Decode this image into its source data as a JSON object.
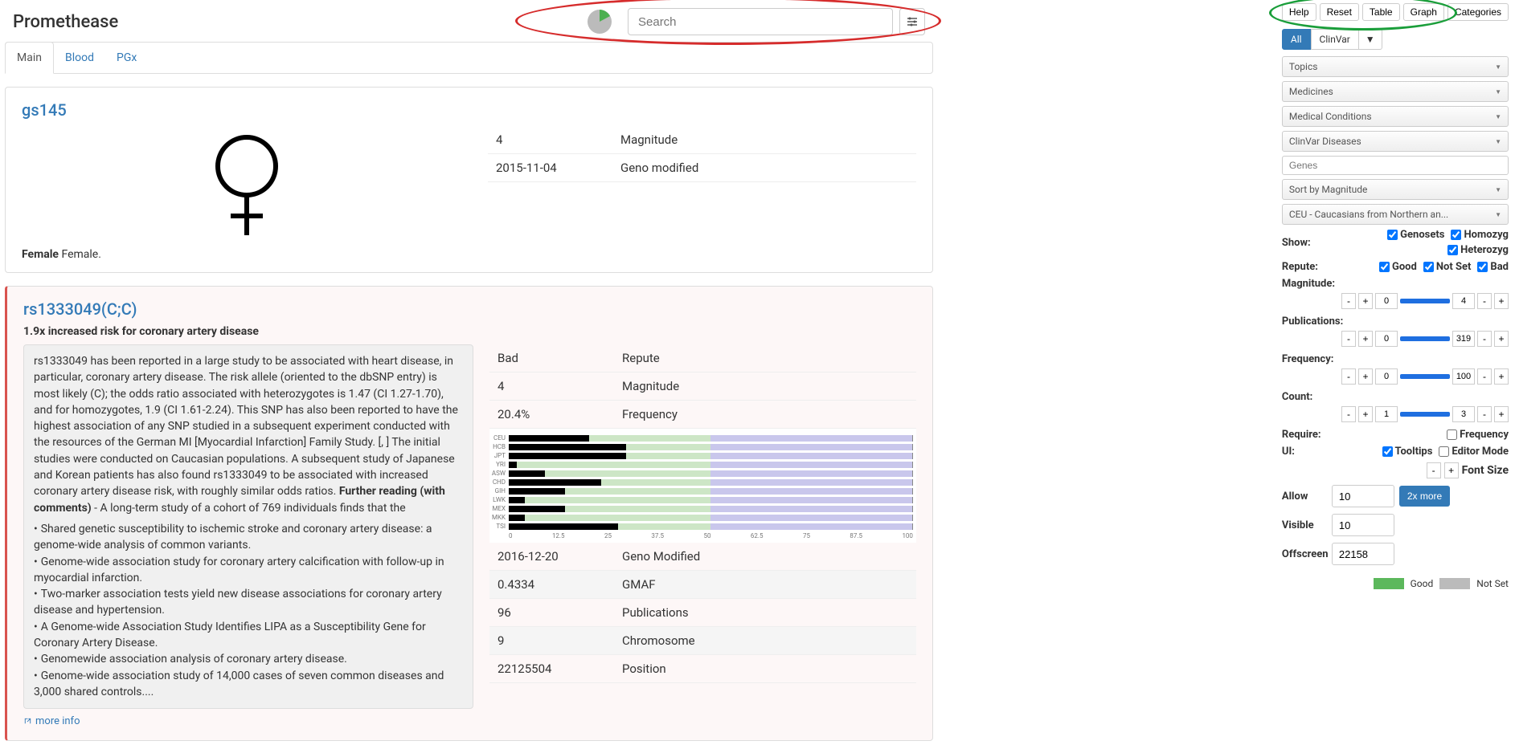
{
  "brand": "Promethease",
  "search": {
    "placeholder": "Search"
  },
  "tabs": [
    "Main",
    "Blood",
    "PGx"
  ],
  "activeTab": 0,
  "card1": {
    "title": "gs145",
    "rows": [
      {
        "v": "4",
        "k": "Magnitude"
      },
      {
        "v": "2015-11-04",
        "k": "Geno modified"
      }
    ],
    "desc_b": "Female",
    "desc": " Female."
  },
  "card2": {
    "title": "rs1333049(C;C)",
    "subtitle": "1.9x increased risk for coronary artery disease",
    "text_p1": "rs1333049 has been reported in a large study to be associated with heart disease, in particular, coronary artery disease. The risk allele (oriented to the dbSNP entry) is most likely (C); the odds ratio associated with heterozygotes is 1.47 (CI 1.27-1.70), and for homozygotes, 1.9 (CI 1.61-2.24). This SNP has also been reported to have the highest association of any SNP studied in a subsequent experiment conducted with the resources of the German MI [Myocardial Infarction] Family Study. [, ] The initial studies were conducted on Caucasian populations. A subsequent study of Japanese and Korean patients has also found rs1333049 to be associated with increased coronary artery disease risk, with roughly similar odds ratios. ",
    "text_b": "Further reading (with comments)",
    "text_p2": " - A long-term study of a cohort of 769 individuals finds that the",
    "bullets": [
      "Shared genetic susceptibility to ischemic stroke and coronary artery disease: a genome-wide analysis of common variants.",
      "Genome-wide association study for coronary artery calcification with follow-up in myocardial infarction.",
      "Two-marker association tests yield new disease associations for coronary artery disease and hypertension.",
      "A Genome-wide Association Study Identifies LIPA as a Susceptibility Gene for Coronary Artery Disease.",
      "Genomewide association analysis of coronary artery disease.",
      "Genome-wide association study of 14,000 cases of seven common diseases and 3,000 shared controls...."
    ],
    "more": "more info",
    "rows1": [
      {
        "v": "Bad",
        "k": "Repute"
      },
      {
        "v": "4",
        "k": "Magnitude"
      },
      {
        "v": "20.4%",
        "k": "Frequency"
      }
    ],
    "rows2": [
      {
        "v": "2016-12-20",
        "k": "Geno Modified"
      },
      {
        "v": "0.4334",
        "k": "GMAF"
      },
      {
        "v": "96",
        "k": "Publications"
      },
      {
        "v": "9",
        "k": "Chromosome"
      },
      {
        "v": "22125504",
        "k": "Position"
      }
    ]
  },
  "chart_data": {
    "type": "bar",
    "title": "",
    "xlabel": "",
    "ylabel": "",
    "xlim": [
      0,
      100
    ],
    "ticks": [
      "0",
      "12.5",
      "25",
      "37.5",
      "50",
      "62.5",
      "75",
      "87.5",
      "100"
    ],
    "categories": [
      "CEU",
      "HCB",
      "JPT",
      "YRI",
      "ASW",
      "CHD",
      "GIH",
      "LWK",
      "MEX",
      "MKK",
      "TSI"
    ],
    "values": [
      20,
      29,
      29,
      2,
      9,
      23,
      14,
      4,
      14,
      4,
      27
    ]
  },
  "rp": {
    "top": [
      "Help",
      "Reset",
      "Table",
      "Graph",
      "Categories"
    ],
    "pills": {
      "all": "All",
      "clinvar": "ClinVar"
    },
    "selects": [
      "Topics",
      "Medicines",
      "Medical Conditions",
      "ClinVar Diseases"
    ],
    "genes_ph": "Genes",
    "sort": "Sort by Magnitude",
    "pop": "CEU - Caucasians from Northern an...",
    "show": {
      "label": "Show:",
      "genosets": "Genosets",
      "homozyg": "Homozyg",
      "heterozyg": "Heterozyg"
    },
    "repute": {
      "label": "Repute:",
      "good": "Good",
      "notset": "Not Set",
      "bad": "Bad"
    },
    "magnitude": {
      "label": "Magnitude:",
      "min": "0",
      "max": "4"
    },
    "publications": {
      "label": "Publications:",
      "min": "0",
      "max": "319"
    },
    "frequency": {
      "label": "Frequency:",
      "min": "0",
      "max": "100"
    },
    "count": {
      "label": "Count:",
      "min": "1",
      "max": "3"
    },
    "require": {
      "label": "Require:",
      "freq": "Frequency"
    },
    "ui": {
      "label": "UI:",
      "tooltips": "Tooltips",
      "editor": "Editor Mode",
      "fontsize": "Font Size"
    },
    "allow": {
      "label": "Allow",
      "v": "10",
      "btn": "2x more"
    },
    "visible": {
      "label": "Visible",
      "v": "10"
    },
    "offscreen": {
      "label": "Offscreen",
      "v": "22158"
    },
    "legend": {
      "good": "Good",
      "notset": "Not Set"
    },
    "colors": {
      "good": "#5cb85c",
      "notset": "#bbb"
    }
  }
}
